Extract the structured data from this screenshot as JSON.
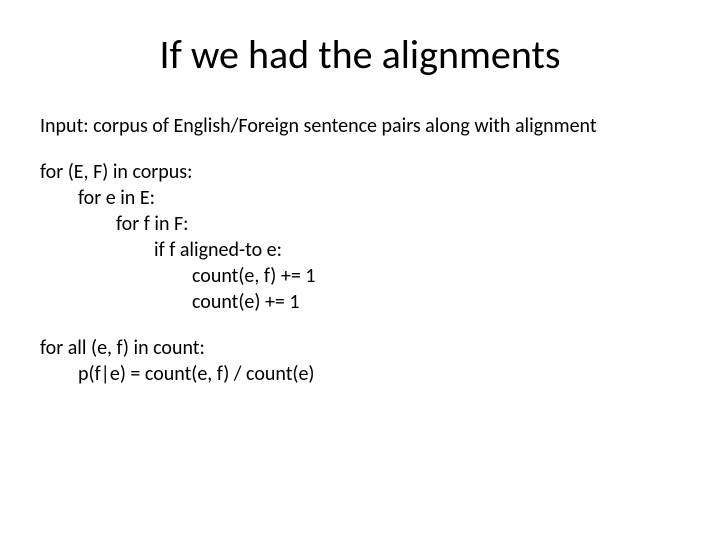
{
  "title": "If we had the alignments",
  "input_line": "Input: corpus of English/Foreign sentence pairs along with alignment",
  "algo": {
    "l1": "for (E, F) in corpus:",
    "l2": "for e in E:",
    "l3": "for f in F:",
    "l4": "if f aligned-to e:",
    "l5": "count(e, f) += 1",
    "l6": "count(e) += 1"
  },
  "post": {
    "l1": "for all (e, f) in count:",
    "l2": "p(f|e) = count(e, f) / count(e)"
  }
}
